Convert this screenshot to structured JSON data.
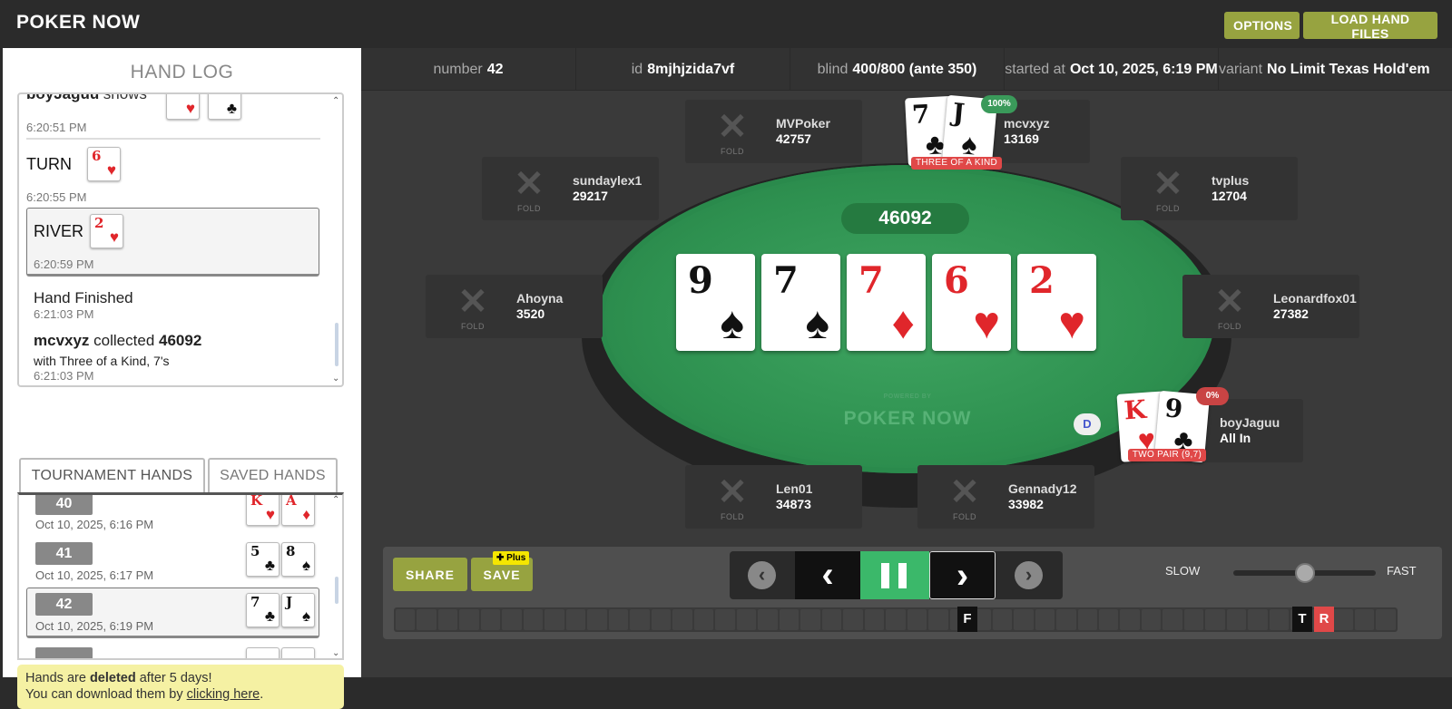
{
  "app": {
    "logo": "POKER NOW",
    "options_btn": "OPTIONS",
    "load_btn": "LOAD HAND FILES"
  },
  "hand_log": {
    "title": "HAND LOG",
    "entries": {
      "shows": {
        "player": "boyJaguu",
        "text": "shows",
        "time": "6:20:51 PM"
      },
      "turn": {
        "label": "TURN",
        "card_rank": "6",
        "card_suit": "♥",
        "time": "6:20:55 PM"
      },
      "river": {
        "label": "RIVER",
        "card_rank": "2",
        "card_suit": "♥",
        "time": "6:20:59 PM"
      },
      "finished": {
        "label": "Hand Finished",
        "time": "6:21:03 PM"
      },
      "collected": {
        "player": "mcvxyz",
        "text": "collected",
        "amount": "46092",
        "detail": "with Three of a Kind, 7's",
        "time": "6:21:03 PM"
      }
    }
  },
  "tabs": {
    "tournament": "TOURNAMENT HANDS",
    "saved": "SAVED HANDS"
  },
  "hands": [
    {
      "num": "40",
      "date": "Oct 10, 2025, 6:16 PM",
      "c1r": "K",
      "c1s": "♥",
      "c2r": "A",
      "c2s": "♦"
    },
    {
      "num": "41",
      "date": "Oct 10, 2025, 6:17 PM",
      "c1r": "5",
      "c1s": "♣",
      "c2r": "8",
      "c2s": "♠"
    },
    {
      "num": "42",
      "date": "Oct 10, 2025, 6:19 PM",
      "c1r": "7",
      "c1s": "♣",
      "c2r": "J",
      "c2s": "♠"
    }
  ],
  "notice": {
    "line1a": "Hands are ",
    "line1b": "deleted",
    "line1c": " after 5 days!",
    "line2a": "You can download them by ",
    "link": "clicking here",
    "line2b": "."
  },
  "info": {
    "number_label": "number",
    "number": "42",
    "id_label": "id",
    "id": "8mjhjzida7vf",
    "blind_label": "blind",
    "blind": "400/800 (ante 350)",
    "started_label": "started at",
    "started": "Oct 10, 2025, 6:19 PM",
    "variant_label": "variant",
    "variant": "No Limit Texas Hold'em"
  },
  "table": {
    "pot": "46092",
    "watermark_small": "POWERED BY",
    "watermark": "POKER NOW",
    "board": [
      {
        "rank": "9",
        "suit": "♠"
      },
      {
        "rank": "7",
        "suit": "♠"
      },
      {
        "rank": "7",
        "suit": "♦"
      },
      {
        "rank": "6",
        "suit": "♥"
      },
      {
        "rank": "2",
        "suit": "♥"
      }
    ],
    "dealer": "D"
  },
  "seats": {
    "mvpoker": {
      "name": "MVPoker",
      "chips": "42757",
      "status": "FOLD"
    },
    "mcvxyz": {
      "name": "mcvxyz",
      "chips": "13169",
      "pct": "100%",
      "hand_rank": "THREE OF A KIND",
      "c1r": "7",
      "c1s": "♣",
      "c2r": "J",
      "c2s": "♠"
    },
    "sundaylex1": {
      "name": "sundaylex1",
      "chips": "29217",
      "status": "FOLD"
    },
    "tvplus": {
      "name": "tvplus",
      "chips": "12704",
      "status": "FOLD"
    },
    "ahoyna": {
      "name": "Ahoyna",
      "chips": "3520",
      "status": "FOLD"
    },
    "leonardfox01": {
      "name": "Leonardfox01",
      "chips": "27382",
      "status": "FOLD"
    },
    "boyjaguu": {
      "name": "boyJaguu",
      "chips": "All In",
      "pct": "0%",
      "hand_rank": "TWO PAIR (9,7)",
      "c1r": "K",
      "c1s": "♥",
      "c2r": "9",
      "c2s": "♣"
    },
    "len01": {
      "name": "Len01",
      "chips": "34873",
      "status": "FOLD"
    },
    "gennady12": {
      "name": "Gennady12",
      "chips": "33982",
      "status": "FOLD"
    }
  },
  "controls": {
    "share": "SHARE",
    "save": "SAVE",
    "plus_badge": "Plus",
    "slow": "SLOW",
    "fast": "FAST",
    "markers": {
      "flop": "F",
      "turn": "T",
      "river": "R"
    }
  }
}
